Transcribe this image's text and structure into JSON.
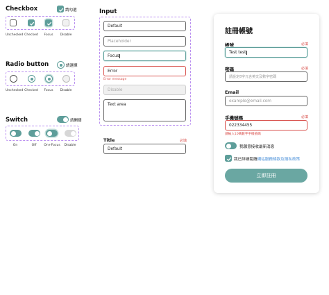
{
  "checkbox": {
    "title": "Checkbox",
    "example_label": "請勾選",
    "states": [
      "Unchecked",
      "Checked",
      "Focus",
      "Disable"
    ]
  },
  "radio": {
    "title": "Radio button",
    "example_label": "請選擇",
    "states": [
      "Unchecked",
      "Checked",
      "Focus",
      "Disable"
    ]
  },
  "switch": {
    "title": "Switch",
    "example_label": "請開關",
    "states": [
      "On",
      "Off",
      "On+Focus",
      "Disable"
    ]
  },
  "input": {
    "title": "Input",
    "default_value": "Default",
    "placeholder": "Placeholder",
    "focus_value": "Focus",
    "error_value": "Error",
    "error_message": "Error message",
    "disabled_value": "Disable",
    "textarea_value": "Text area"
  },
  "titled_field": {
    "title": "Title",
    "required": "必填",
    "value": "Default"
  },
  "form": {
    "title": "註冊帳號",
    "account_label": "帳號",
    "account_required": "必填",
    "account_value": "Test test",
    "password_label": "密碼",
    "password_required": "必填",
    "password_placeholder": "請設定8字元含英文及數字密碼",
    "email_label": "Email",
    "email_placeholder": "example@email.com",
    "phone_label": "手機號碼",
    "phone_required": "必填",
    "phone_value": "022334455",
    "phone_error": "請輸入10碼數字手機號碼",
    "newsletter_label": "我願意接收最新消息",
    "terms_prefix": "我已詳細閱讀",
    "terms_link": "網站服務條款及隱私政策",
    "submit_label": "立即註冊",
    "accent_color": "#5e9e9a",
    "error_color": "#d9534f"
  }
}
